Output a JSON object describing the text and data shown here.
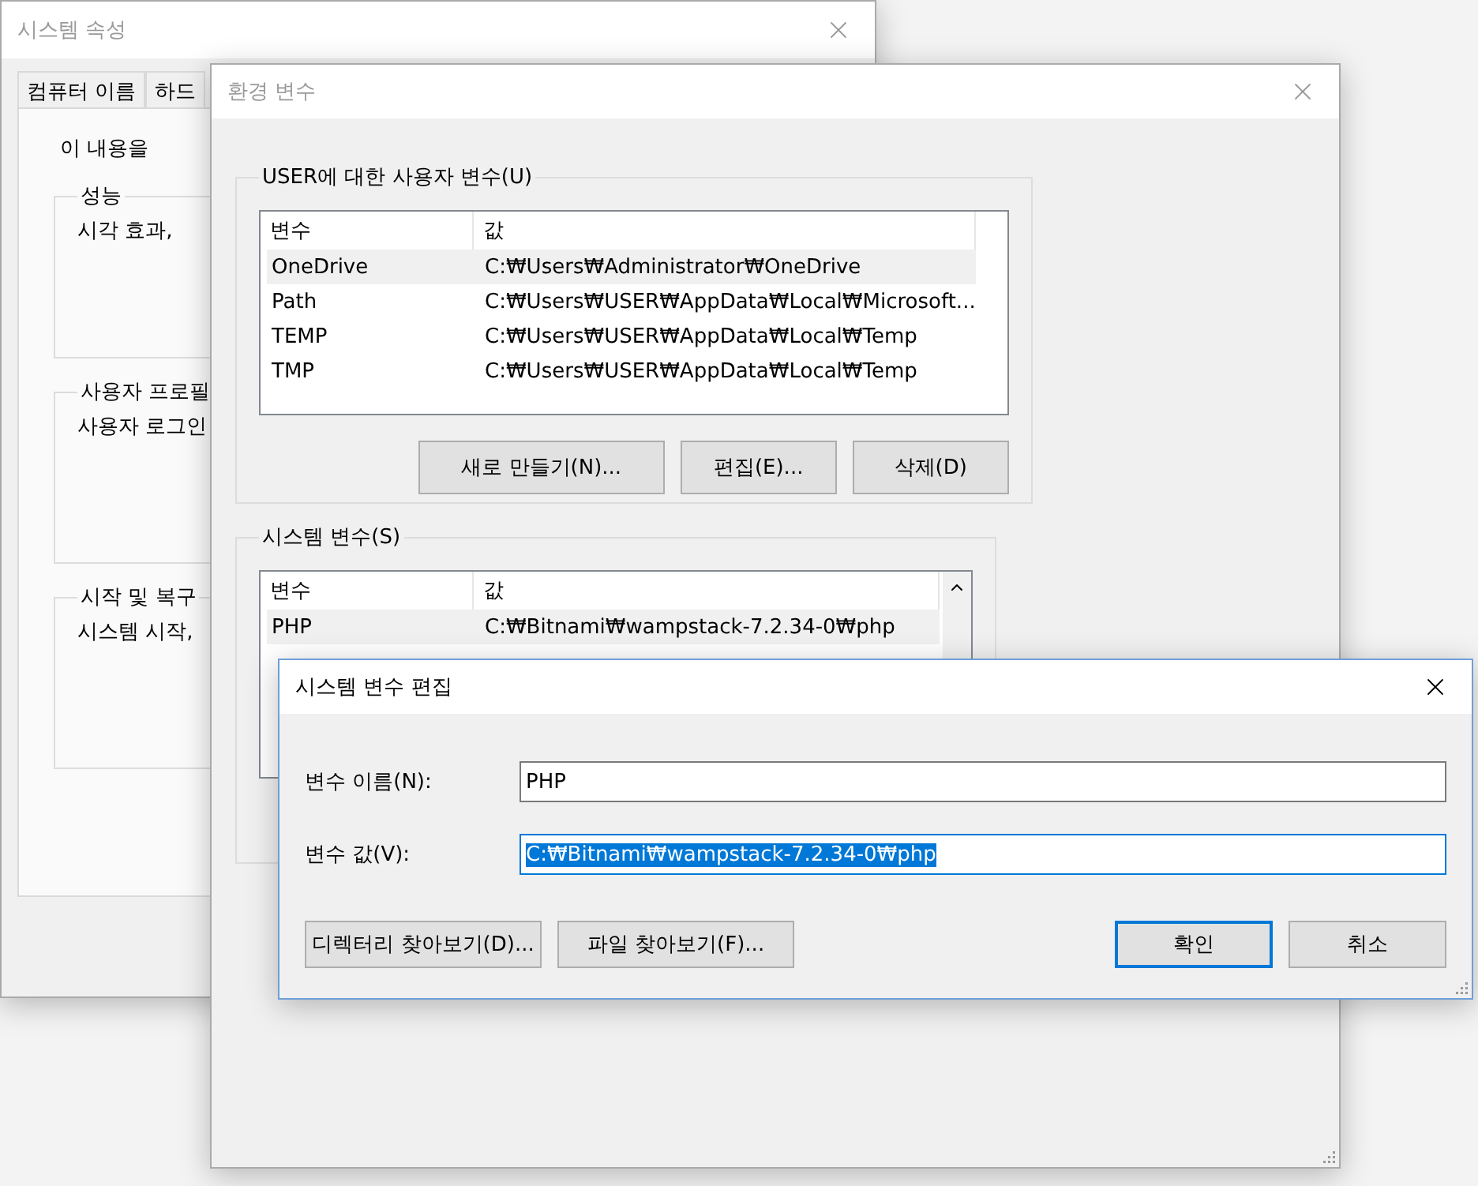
{
  "system_properties": {
    "title": "시스템 속성",
    "tabs": [
      {
        "label": "컴퓨터 이름",
        "selected": false
      },
      {
        "label": "하드",
        "selected": false
      }
    ],
    "intro": "이 내용을",
    "groups": [
      {
        "title": "성능",
        "text": "시각 효과,"
      },
      {
        "title": "사용자 프로필",
        "text": "사용자 로그인"
      },
      {
        "title": "시작 및 복구",
        "text": "시스템 시작,"
      }
    ]
  },
  "environment_variables": {
    "title": "환경 변수",
    "user_group": {
      "title": "USER에 대한 사용자 변수(U)",
      "columns": [
        "변수",
        "값"
      ],
      "rows": [
        {
          "name": "OneDrive",
          "value": "C:₩Users₩Administrator₩OneDrive",
          "selected": true
        },
        {
          "name": "Path",
          "value": "C:₩Users₩USER₩AppData₩Local₩Microsoft...",
          "selected": false
        },
        {
          "name": "TEMP",
          "value": "C:₩Users₩USER₩AppData₩Local₩Temp",
          "selected": false
        },
        {
          "name": "TMP",
          "value": "C:₩Users₩USER₩AppData₩Local₩Temp",
          "selected": false
        }
      ],
      "buttons": [
        "새로 만들기(N)...",
        "편집(E)...",
        "삭제(D)"
      ]
    },
    "system_group": {
      "title": "시스템 변수(S)",
      "columns": [
        "변수",
        "값"
      ],
      "rows": [
        {
          "name": "PHP",
          "value": "C:₩Bitnami₩wampstack-7.2.34-0₩php",
          "selected": true
        }
      ]
    }
  },
  "edit_dialog": {
    "title": "시스템 변수 편집",
    "fields": [
      {
        "label": "변수 이름(N):",
        "value": "PHP",
        "text_selected": false,
        "focused": false
      },
      {
        "label": "변수 값(V):",
        "value": "C:₩Bitnami₩wampstack-7.2.34-0₩php",
        "text_selected": true,
        "focused": true
      }
    ],
    "left_buttons": [
      "디렉터리 찾아보기(D)...",
      "파일 찾아보기(F)..."
    ],
    "right_buttons": [
      {
        "label": "확인",
        "default": true
      },
      {
        "label": "취소",
        "default": false
      }
    ]
  }
}
